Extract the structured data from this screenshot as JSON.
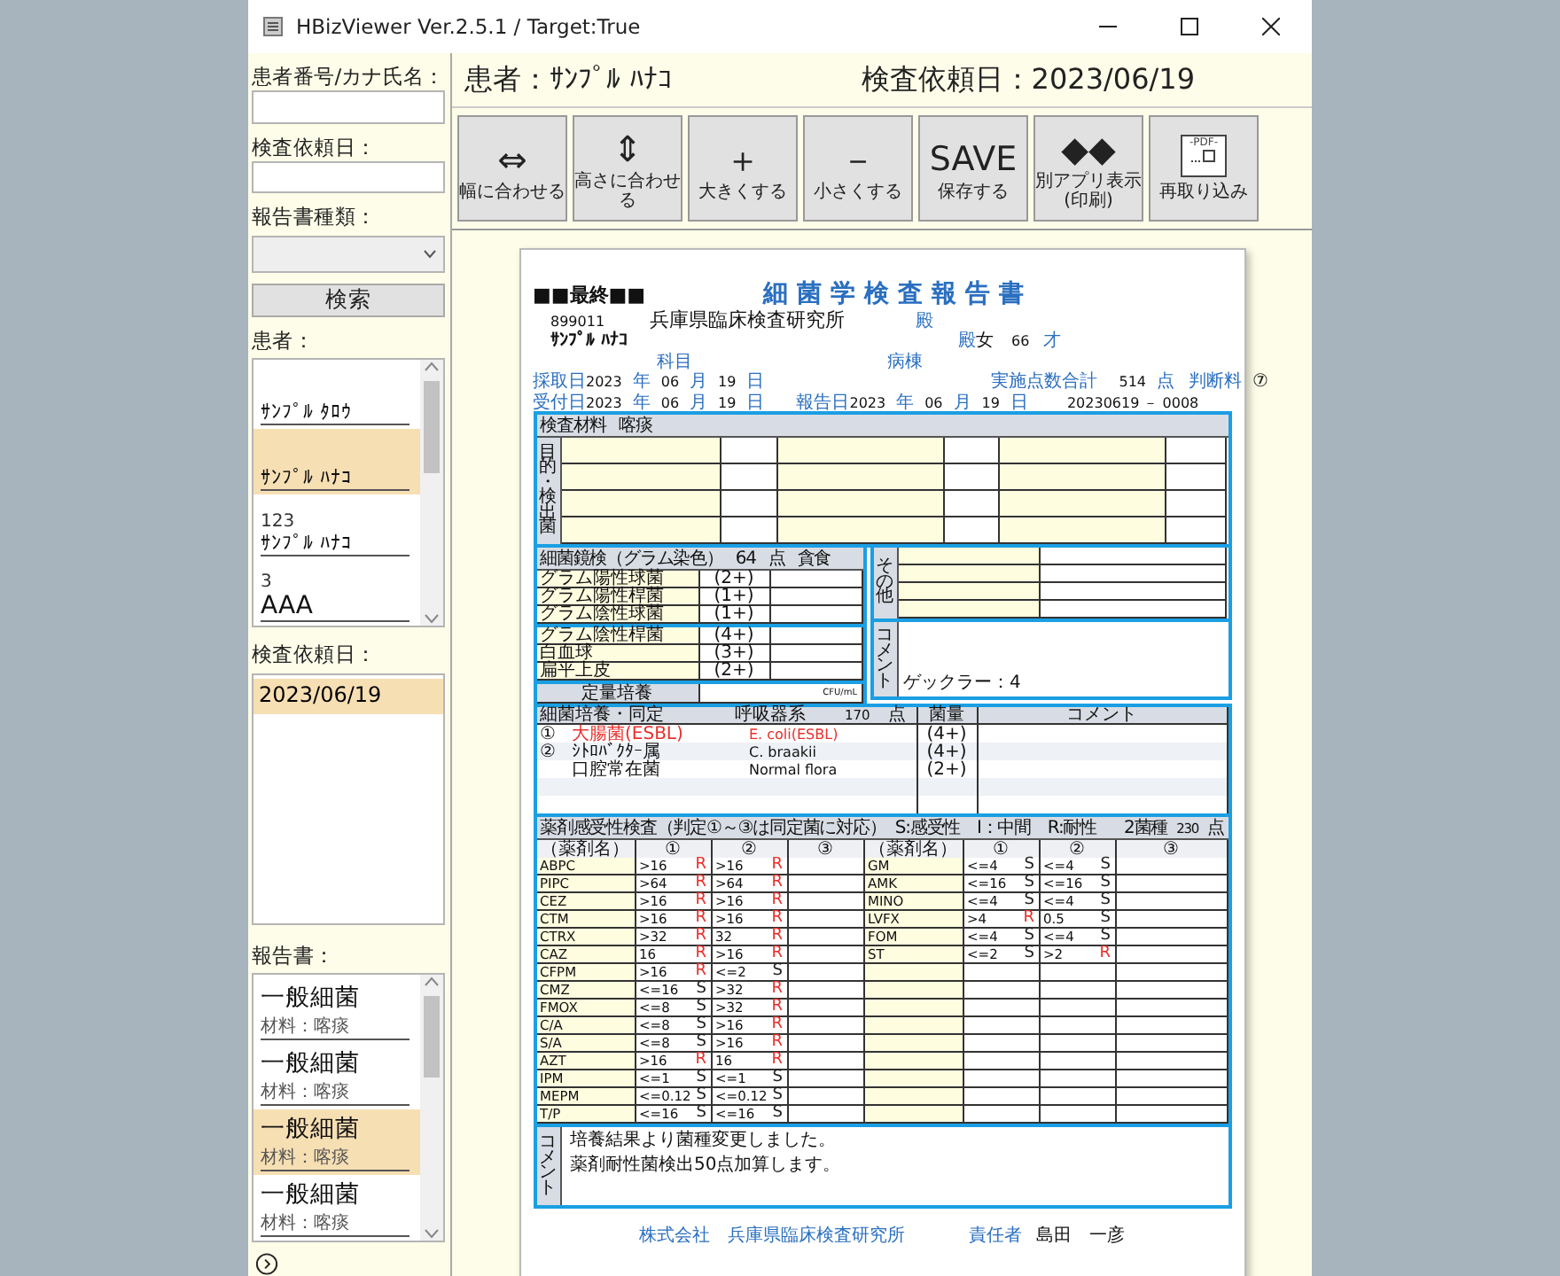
{
  "window": {
    "title": "HBizViewer Ver.2.5.1 / Target:True"
  },
  "sidebar": {
    "patient_search_label": "患者番号/カナ氏名：",
    "date_label": "検査依頼日：",
    "report_type_label": "報告書種類：",
    "search_button": "検索",
    "patients_label": "患者：",
    "patients": [
      {
        "name": "ｻﾝﾌﾟﾙ ﾀﾛｳ",
        "selected": false
      },
      {
        "name": "ｻﾝﾌﾟﾙ ﾊﾅｺ",
        "selected": true
      },
      {
        "id": "123",
        "name": "ｻﾝﾌﾟﾙ ﾊﾅｺ",
        "selected": false
      },
      {
        "id": "3",
        "name": "AAA",
        "selected": false
      }
    ],
    "dates_label": "検査依頼日：",
    "dates": [
      {
        "text": "2023/06/19",
        "selected": true
      }
    ],
    "reports_label": "報告書：",
    "reports": [
      {
        "title": "一般細菌",
        "material": "材料：喀痰",
        "selected": false
      },
      {
        "title": "一般細菌",
        "material": "材料：喀痰",
        "selected": false
      },
      {
        "title": "一般細菌",
        "material": "材料：喀痰",
        "selected": true
      },
      {
        "title": "一般細菌",
        "material": "材料：喀痰",
        "selected": false
      }
    ]
  },
  "header": {
    "patient": "患者：ｻﾝﾌﾟﾙ ﾊﾅｺ",
    "request_date": "検査依頼日：2023/06/19"
  },
  "toolbar": [
    {
      "kind": "symbol",
      "symbol": "⇔",
      "label": "幅に合わせる"
    },
    {
      "kind": "symbol",
      "symbol": "⇕",
      "label": "高さに合わせる"
    },
    {
      "kind": "symbol",
      "symbol": "＋",
      "label": "大きくする"
    },
    {
      "kind": "symbol",
      "symbol": "－",
      "label": "小さくする"
    },
    {
      "kind": "word",
      "symbol": "SAVE",
      "label": "保存する"
    },
    {
      "kind": "symbol",
      "symbol": "◆◆",
      "label": "別アプリ表示\n(印刷)"
    },
    {
      "kind": "pdf",
      "symbol": "-PDF-",
      "label": "再取り込み"
    }
  ],
  "report": {
    "status": "■■最終■■",
    "title": "細菌学検査報告書",
    "sp_no": "899011",
    "hospital": "兵庫県臨床検査研究所",
    "hospital_suffix": "殿",
    "patient_name": "ｻﾝﾌﾟﾙ ﾊﾅｺ",
    "patient_suffix": "殿",
    "sex": "女",
    "age": "66",
    "age_unit": "才",
    "sub_labels": [
      "科目",
      "病棟"
    ],
    "collected": {
      "label": "採取日",
      "parts": [
        {
          "value": "2023",
          "unit": "年"
        },
        {
          "value": "06",
          "unit": "月"
        },
        {
          "value": "19",
          "unit": "日"
        }
      ]
    },
    "received": {
      "label": "受付日",
      "parts": [
        {
          "value": "2023",
          "unit": "年"
        },
        {
          "value": "06",
          "unit": "月"
        },
        {
          "value": "19",
          "unit": "日"
        }
      ]
    },
    "reported": {
      "label": "報告日",
      "parts": [
        {
          "value": "2023",
          "unit": "年"
        },
        {
          "value": "06",
          "unit": "月"
        },
        {
          "value": "19",
          "unit": "日"
        }
      ]
    },
    "points_label": "実施点数合計",
    "points": "514",
    "points_unit": "点",
    "judgment_label": "判断料",
    "judgment": "⑦",
    "report_no": "20230619 － 0008",
    "material_label": "検査材料",
    "material": "喀痰",
    "purpose_label": "目的・検出菌",
    "gram": {
      "title": "細菌鏡検（グラム染色）",
      "points": "64",
      "unit": "点",
      "extra": "貪食",
      "rows": [
        {
          "name": "グラム陽性球菌",
          "grade": "(2+)"
        },
        {
          "name": "グラム陽性桿菌",
          "grade": "(1+)"
        },
        {
          "name": "グラム陰性球菌",
          "grade": "(1+)"
        },
        {
          "name": "グラム陰性桿菌",
          "grade": "(4+)"
        },
        {
          "name": "白血球",
          "grade": "(3+)"
        },
        {
          "name": "扁平上皮",
          "grade": "(2+)"
        }
      ],
      "quant_label": "定量培養",
      "quant_unit": "CFU/mL"
    },
    "other_label": "その他",
    "comment_label": "コメント",
    "comment": "ゲックラー：4",
    "culture": {
      "title": "細菌培養・同定",
      "system": "呼吸器系",
      "points": "170",
      "unit": "点",
      "amount_label": "菌量",
      "comment_label": "コメント",
      "rows": [
        {
          "no": "①",
          "name": "大腸菌(ESBL)",
          "species": "E. coli(ESBL)",
          "amount": "(4+)",
          "alert": true
        },
        {
          "no": "②",
          "name": "ｼﾄﾛﾊﾞｸﾀｰ属",
          "species": "C. braakii",
          "amount": "(4+)",
          "alert": false
        },
        {
          "name": "口腔常在菌",
          "species": "Normal flora",
          "amount": "(2+)",
          "alert": false
        }
      ]
    },
    "sensitivity": {
      "title": "薬剤感受性検査（判定①～③は同定菌に対応）",
      "legend": "S:感受性　I：中間　R:耐性",
      "species_count": "2菌種",
      "points": "230",
      "unit": "点",
      "columns": [
        "（薬剤名）",
        "①",
        "②",
        "③",
        "（薬剤名）",
        "①",
        "②",
        "③"
      ],
      "left": [
        {
          "drug": "ABPC",
          "results": [
            {
              "value": ">16",
              "judgment": "R"
            },
            {
              "value": ">16",
              "judgment": "R"
            }
          ]
        },
        {
          "drug": "PIPC",
          "results": [
            {
              "value": ">64",
              "judgment": "R"
            },
            {
              "value": ">64",
              "judgment": "R"
            }
          ]
        },
        {
          "drug": "CEZ",
          "results": [
            {
              "value": ">16",
              "judgment": "R"
            },
            {
              "value": ">16",
              "judgment": "R"
            }
          ]
        },
        {
          "drug": "CTM",
          "results": [
            {
              "value": ">16",
              "judgment": "R"
            },
            {
              "value": ">16",
              "judgment": "R"
            }
          ]
        },
        {
          "drug": "CTRX",
          "results": [
            {
              "value": ">32",
              "judgment": "R"
            },
            {
              "value": "32",
              "judgment": "R"
            }
          ]
        },
        {
          "drug": "CAZ",
          "results": [
            {
              "value": "16",
              "judgment": "R"
            },
            {
              "value": ">16",
              "judgment": "R"
            }
          ]
        },
        {
          "drug": "CFPM",
          "results": [
            {
              "value": ">16",
              "judgment": "R"
            },
            {
              "value": "<=2",
              "judgment": "S"
            }
          ]
        },
        {
          "drug": "CMZ",
          "results": [
            {
              "value": "<=16",
              "judgment": "S"
            },
            {
              "value": ">32",
              "judgment": "R"
            }
          ]
        },
        {
          "drug": "FMOX",
          "results": [
            {
              "value": "<=8",
              "judgment": "S"
            },
            {
              "value": ">32",
              "judgment": "R"
            }
          ]
        },
        {
          "drug": "C/A",
          "results": [
            {
              "value": "<=8",
              "judgment": "S"
            },
            {
              "value": ">16",
              "judgment": "R"
            }
          ]
        },
        {
          "drug": "S/A",
          "results": [
            {
              "value": "<=8",
              "judgment": "S"
            },
            {
              "value": ">16",
              "judgment": "R"
            }
          ]
        },
        {
          "drug": "AZT",
          "results": [
            {
              "value": ">16",
              "judgment": "R"
            },
            {
              "value": "16",
              "judgment": "R"
            }
          ]
        },
        {
          "drug": "IPM",
          "results": [
            {
              "value": "<=1",
              "judgment": "S"
            },
            {
              "value": "<=1",
              "judgment": "S"
            }
          ]
        },
        {
          "drug": "MEPM",
          "results": [
            {
              "value": "<=0.12",
              "judgment": "S"
            },
            {
              "value": "<=0.12",
              "judgment": "S"
            }
          ]
        },
        {
          "drug": "T/P",
          "results": [
            {
              "value": "<=16",
              "judgment": "S"
            },
            {
              "value": "<=16",
              "judgment": "S"
            }
          ]
        }
      ],
      "right": [
        {
          "drug": "GM",
          "results": [
            {
              "value": "<=4",
              "judgment": "S"
            },
            {
              "value": "<=4",
              "judgment": "S"
            }
          ]
        },
        {
          "drug": "AMK",
          "results": [
            {
              "value": "<=16",
              "judgment": "S"
            },
            {
              "value": "<=16",
              "judgment": "S"
            }
          ]
        },
        {
          "drug": "MINO",
          "results": [
            {
              "value": "<=4",
              "judgment": "S"
            },
            {
              "value": "<=4",
              "judgment": "S"
            }
          ]
        },
        {
          "drug": "LVFX",
          "results": [
            {
              "value": ">4",
              "judgment": "R"
            },
            {
              "value": "0.5",
              "judgment": "S"
            }
          ]
        },
        {
          "drug": "FOM",
          "results": [
            {
              "value": "<=4",
              "judgment": "S"
            },
            {
              "value": "<=4",
              "judgment": "S"
            }
          ]
        },
        {
          "drug": "ST",
          "results": [
            {
              "value": "<=2",
              "judgment": "S"
            },
            {
              "value": ">2",
              "judgment": "R"
            }
          ]
        }
      ]
    },
    "final_comment_label": "コメント",
    "final_comment": [
      "培養結果より菌種変更しました。",
      "薬剤耐性菌検出50点加算します。"
    ],
    "company": "株式会社　兵庫県臨床検査研究所",
    "manager_label": "責任者",
    "manager": "島田　一彦"
  }
}
